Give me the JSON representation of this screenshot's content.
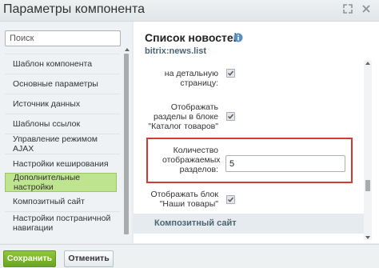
{
  "window": {
    "title": "Параметры компонента"
  },
  "search": {
    "placeholder": "Поиск"
  },
  "sidebar": {
    "items": [
      {
        "label": "Шаблон компонента"
      },
      {
        "label": "Основные параметры"
      },
      {
        "label": "Источник данных"
      },
      {
        "label": "Шаблоны ссылок"
      },
      {
        "label": "Управление режимом AJAX"
      },
      {
        "label": "Настройки кеширования"
      },
      {
        "label": "Дополнительные настройки",
        "active": true
      },
      {
        "label": "Композитный сайт"
      },
      {
        "label": "Настройки постраничной навигации"
      }
    ]
  },
  "main": {
    "title": "Список новостей",
    "code": "bitrix:news.list",
    "fields": [
      {
        "label": "на детальную страницу:",
        "checked": true
      },
      {
        "label": "Отображать разделы в блоке \"Каталог товаров\"",
        "checked": true
      },
      {
        "label": "Количество отображаемых разделов:",
        "value": "5"
      },
      {
        "label": "Отображать блок \"Наши товары\"",
        "checked": true
      }
    ],
    "group_header": "Композитный сайт"
  },
  "footer": {
    "save_label": "Сохранить",
    "cancel_label": "Отменить"
  },
  "colors": {
    "accent": "#7db52f",
    "active_item": "#bee48f",
    "highlight": "#d13a35"
  }
}
